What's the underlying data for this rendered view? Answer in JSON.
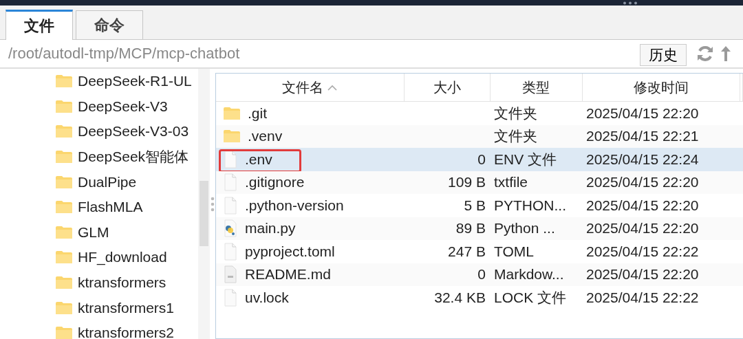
{
  "tabs": [
    {
      "label": "文件",
      "selected": true
    },
    {
      "label": "命令",
      "selected": false
    }
  ],
  "path": "/root/autodl-tmp/MCP/mcp-chatbot",
  "history_button": "历史",
  "sidebar": {
    "items": [
      {
        "label": "DeepSeek-R1-UL"
      },
      {
        "label": "DeepSeek-V3"
      },
      {
        "label": "DeepSeek-V3-03"
      },
      {
        "label": "DeepSeek智能体"
      },
      {
        "label": "DualPipe"
      },
      {
        "label": "FlashMLA"
      },
      {
        "label": "GLM"
      },
      {
        "label": "HF_download"
      },
      {
        "label": "ktransformers"
      },
      {
        "label": "ktransformers1"
      },
      {
        "label": "ktransformers2"
      }
    ]
  },
  "table": {
    "columns": [
      "文件名",
      "大小",
      "类型",
      "修改时间"
    ],
    "rows": [
      {
        "kind": "folder",
        "name": ".git",
        "size": "",
        "type": "文件夹",
        "modified": "2025/04/15 22:20",
        "selected": false,
        "highlighted": false
      },
      {
        "kind": "folder",
        "name": ".venv",
        "size": "",
        "type": "文件夹",
        "modified": "2025/04/15 22:21",
        "selected": false,
        "highlighted": false
      },
      {
        "kind": "file",
        "name": ".env",
        "size": "0",
        "type": "ENV 文件",
        "modified": "2025/04/15 22:24",
        "selected": true,
        "highlighted": true
      },
      {
        "kind": "file",
        "name": ".gitignore",
        "size": "109 B",
        "type": "txtfile",
        "modified": "2025/04/15 22:20",
        "selected": false,
        "highlighted": false
      },
      {
        "kind": "file",
        "name": ".python-version",
        "size": "5 B",
        "type": "PYTHON...",
        "modified": "2025/04/15 22:20",
        "selected": false,
        "highlighted": false
      },
      {
        "kind": "python",
        "name": "main.py",
        "size": "89 B",
        "type": "Python ...",
        "modified": "2025/04/15 22:20",
        "selected": false,
        "highlighted": false
      },
      {
        "kind": "file",
        "name": "pyproject.toml",
        "size": "247 B",
        "type": "TOML",
        "modified": "2025/04/15 22:22",
        "selected": false,
        "highlighted": false
      },
      {
        "kind": "doc",
        "name": "README.md",
        "size": "0",
        "type": "Markdow...",
        "modified": "2025/04/15 22:20",
        "selected": false,
        "highlighted": false
      },
      {
        "kind": "file",
        "name": "uv.lock",
        "size": "32.4 KB",
        "type": "LOCK 文件",
        "modified": "2025/04/15 22:22",
        "selected": false,
        "highlighted": false
      }
    ]
  }
}
